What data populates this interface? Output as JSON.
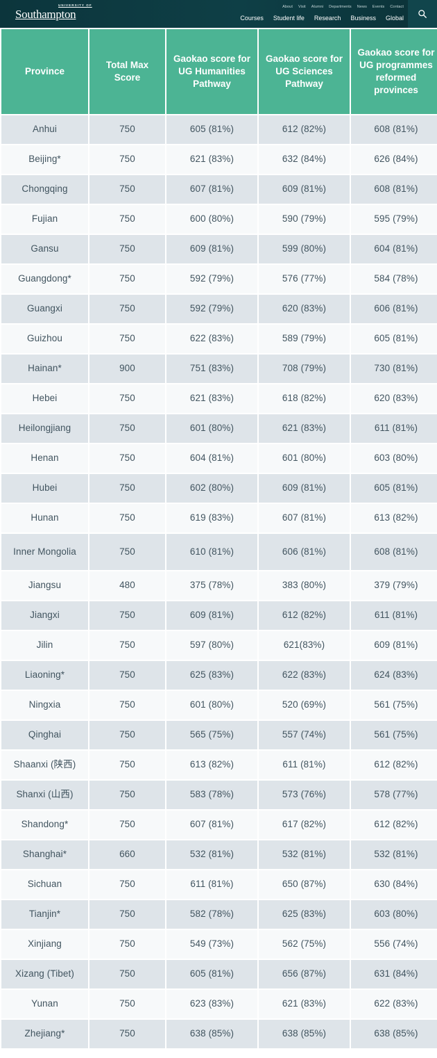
{
  "site": {
    "logo": {
      "pre_text": "UNIVERSITY OF",
      "name": "Southampton"
    },
    "utility_nav": [
      "About",
      "Visit",
      "Alumni",
      "Departments",
      "News",
      "Events",
      "Contact"
    ],
    "main_nav": [
      "Courses",
      "Student life",
      "Research",
      "Business",
      "Global"
    ],
    "search_icon": "search-icon",
    "colors": {
      "header_bg": "#0d3b41",
      "search_bg": "#11454c",
      "table_header_green": "#4cb494",
      "row_odd": "#dee4e9",
      "row_even": "#f7f9fa",
      "cell_text": "#41545f"
    }
  },
  "table": {
    "headers": [
      "Province",
      "Total Max Score",
      "Gaokao score for UG Humanities Pathway",
      "Gaokao score for UG Sciences Pathway",
      "Gaokao score for UG programmes reformed provinces"
    ],
    "rows": [
      {
        "province": "Anhui",
        "max": "750",
        "humanities": "605 (81%)",
        "sciences": "612 (82%)",
        "reformed": "608 (81%)"
      },
      {
        "province": "Beijing*",
        "max": "750",
        "humanities": "621 (83%)",
        "sciences": "632 (84%)",
        "reformed": "626 (84%)"
      },
      {
        "province": "Chongqing",
        "max": "750",
        "humanities": "607 (81%)",
        "sciences": "609 (81%)",
        "reformed": "608 (81%)"
      },
      {
        "province": "Fujian",
        "max": "750",
        "humanities": "600 (80%)",
        "sciences": "590 (79%)",
        "reformed": "595 (79%)"
      },
      {
        "province": "Gansu",
        "max": "750",
        "humanities": "609 (81%)",
        "sciences": "599 (80%)",
        "reformed": "604 (81%)"
      },
      {
        "province": "Guangdong*",
        "max": "750",
        "humanities": "592 (79%)",
        "sciences": "576 (77%)",
        "reformed": "584 (78%)"
      },
      {
        "province": "Guangxi",
        "max": "750",
        "humanities": "592 (79%)",
        "sciences": "620 (83%)",
        "reformed": "606 (81%)"
      },
      {
        "province": "Guizhou",
        "max": "750",
        "humanities": "622 (83%)",
        "sciences": "589 (79%)",
        "reformed": "605 (81%)"
      },
      {
        "province": "Hainan*",
        "max": "900",
        "humanities": "751 (83%)",
        "sciences": "708 (79%)",
        "reformed": "730 (81%)"
      },
      {
        "province": "Hebei",
        "max": "750",
        "humanities": "621 (83%)",
        "sciences": "618 (82%)",
        "reformed": "620 (83%)"
      },
      {
        "province": "Heilongjiang",
        "max": "750",
        "humanities": "601 (80%)",
        "sciences": "621 (83%)",
        "reformed": "611 (81%)"
      },
      {
        "province": "Henan",
        "max": "750",
        "humanities": "604 (81%)",
        "sciences": "601 (80%)",
        "reformed": "603 (80%)"
      },
      {
        "province": "Hubei",
        "max": "750",
        "humanities": "602 (80%)",
        "sciences": "609 (81%)",
        "reformed": "605 (81%)"
      },
      {
        "province": "Hunan",
        "max": "750",
        "humanities": "619 (83%)",
        "sciences": "607 (81%)",
        "reformed": "613 (82%)"
      },
      {
        "province": "Inner Mongolia",
        "max": "750",
        "humanities": "610 (81%)",
        "sciences": "606 (81%)",
        "reformed": "608 (81%)",
        "tall": true
      },
      {
        "province": "Jiangsu",
        "max": "480",
        "humanities": "375 (78%)",
        "sciences": "383 (80%)",
        "reformed": "379 (79%)"
      },
      {
        "province": "Jiangxi",
        "max": "750",
        "humanities": "609 (81%)",
        "sciences": "612 (82%)",
        "reformed": "611 (81%)"
      },
      {
        "province": "Jilin",
        "max": "750",
        "humanities": "597 (80%)",
        "sciences": "621(83%)",
        "reformed": "609 (81%)"
      },
      {
        "province": "Liaoning*",
        "max": "750",
        "humanities": "625 (83%)",
        "sciences": "622 (83%)",
        "reformed": "624 (83%)"
      },
      {
        "province": "Ningxia",
        "max": "750",
        "humanities": "601 (80%)",
        "sciences": "520 (69%)",
        "reformed": "561 (75%)"
      },
      {
        "province": "Qinghai",
        "max": "750",
        "humanities": "565 (75%)",
        "sciences": "557 (74%)",
        "reformed": "561 (75%)"
      },
      {
        "province": "Shaanxi (陕西)",
        "max": "750",
        "humanities": "613 (82%)",
        "sciences": "611 (81%)",
        "reformed": "612 (82%)"
      },
      {
        "province": "Shanxi (山西)",
        "max": "750",
        "humanities": "583 (78%)",
        "sciences": "573 (76%)",
        "reformed": "578 (77%)"
      },
      {
        "province": "Shandong*",
        "max": "750",
        "humanities": "607 (81%)",
        "sciences": "617 (82%)",
        "reformed": "612 (82%)"
      },
      {
        "province": "Shanghai*",
        "max": "660",
        "humanities": "532 (81%)",
        "sciences": "532 (81%)",
        "reformed": "532 (81%)"
      },
      {
        "province": "Sichuan",
        "max": "750",
        "humanities": "611 (81%)",
        "sciences": "650 (87%)",
        "reformed": "630 (84%)"
      },
      {
        "province": "Tianjin*",
        "max": "750",
        "humanities": "582 (78%)",
        "sciences": "625 (83%)",
        "reformed": "603 (80%)"
      },
      {
        "province": "Xinjiang",
        "max": "750",
        "humanities": "549 (73%)",
        "sciences": "562 (75%)",
        "reformed": "556 (74%)"
      },
      {
        "province": "Xizang (Tibet)",
        "max": "750",
        "humanities": "605 (81%)",
        "sciences": "656 (87%)",
        "reformed": "631 (84%)"
      },
      {
        "province": "Yunan",
        "max": "750",
        "humanities": "623 (83%)",
        "sciences": "621 (83%)",
        "reformed": "622 (83%)"
      },
      {
        "province": "Zhejiang*",
        "max": "750",
        "humanities": "638 (85%)",
        "sciences": "638 (85%)",
        "reformed": "638 (85%)"
      }
    ]
  }
}
